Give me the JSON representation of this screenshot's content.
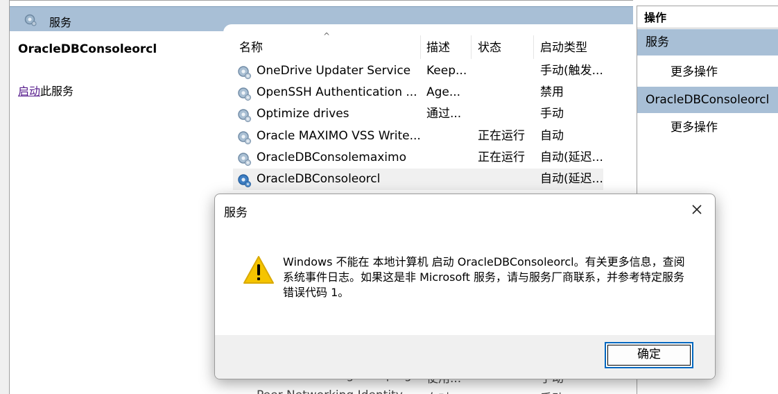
{
  "center": {
    "header_title": "服务",
    "service_name": "OracleDBConsoleorcl",
    "action_link": "启动",
    "action_suffix": "此服务"
  },
  "list": {
    "columns": [
      "名称",
      "描述",
      "状态",
      "启动类型"
    ],
    "rows": [
      {
        "name": "OneDrive Updater Service",
        "desc": "Keep...",
        "status": "",
        "startup": "手动(触发..."
      },
      {
        "name": "OpenSSH Authentication ...",
        "desc": "Age...",
        "status": "",
        "startup": "禁用"
      },
      {
        "name": "Optimize drives",
        "desc": "通过...",
        "status": "",
        "startup": "手动"
      },
      {
        "name": "Oracle MAXIMO VSS Write...",
        "desc": "",
        "status": "正在运行",
        "startup": "自动"
      },
      {
        "name": "OracleDBConsolemaximo",
        "desc": "",
        "status": "正在运行",
        "startup": "自动(延迟..."
      },
      {
        "name": "OracleDBConsoleorcl",
        "desc": "",
        "status": "",
        "startup": "自动(延迟..."
      }
    ],
    "ghost_rows": [
      {
        "name": "Peer Networking Grouping",
        "desc": "使用...",
        "startup": "手动"
      },
      {
        "name": "Peer Networking Identity",
        "desc": "向对...",
        "startup": "手动"
      }
    ]
  },
  "actions": {
    "header": "操作",
    "section1": "服务",
    "section1_item": "更多操作",
    "section2": "OracleDBConsoleorcl",
    "section2_item": "更多操作"
  },
  "dialog": {
    "title": "服务",
    "message": "Windows 不能在 本地计算机 启动 OracleDBConsoleorcl。有关更多信息，查阅系统事件日志。如果这是非 Microsoft 服务，请与服务厂商联系，并参考特定服务错误代码 1。",
    "ok_label": "确定"
  },
  "colors": {
    "header_bg": "#a8bfd6",
    "selection": "#f0f0f0",
    "warning": "#f5c400",
    "button_border": "#0067c0"
  }
}
